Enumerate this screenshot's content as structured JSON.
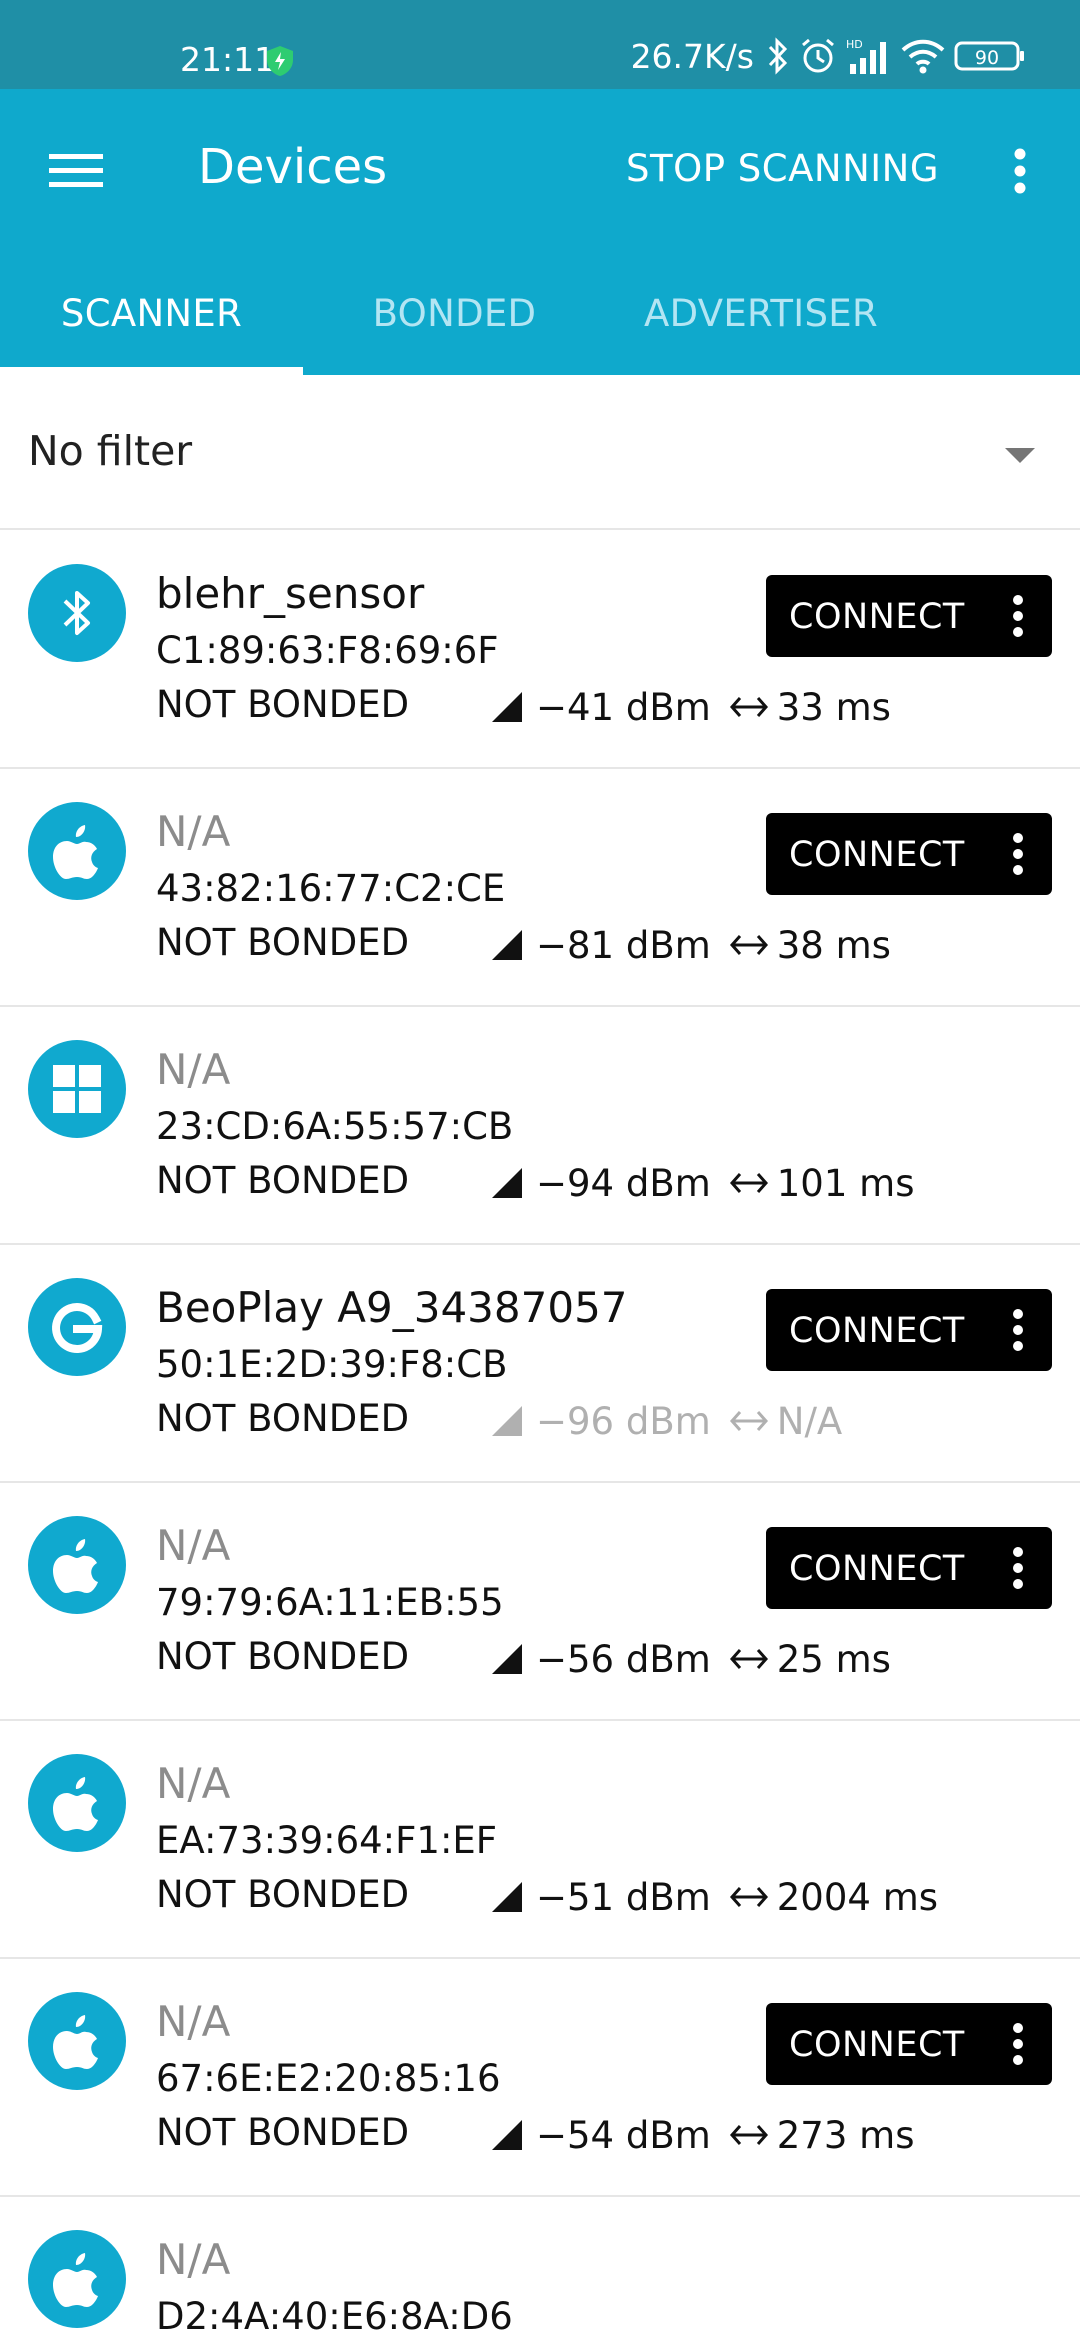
{
  "status_bar": {
    "time": "21:11",
    "net_speed": "26.7K/s",
    "battery": "90",
    "icons": [
      "shield-icon",
      "bluetooth-icon",
      "alarm-icon",
      "cell-signal-icon",
      "wifi-icon",
      "battery-icon"
    ]
  },
  "app_bar": {
    "title": "Devices",
    "action_label": "STOP SCANNING",
    "icons": [
      "menu-icon",
      "more-vert-icon"
    ],
    "background": "#0fa9cc",
    "status_background": "#1f8fa6"
  },
  "tabs": [
    {
      "label": "SCANNER",
      "active": true
    },
    {
      "label": "BONDED",
      "active": false
    },
    {
      "label": "ADVERTISER",
      "active": false
    }
  ],
  "filter": {
    "label": "No filter"
  },
  "devices": [
    {
      "icon": "bluetooth-icon",
      "name": "blehr_sensor",
      "name_available": true,
      "address": "C1:89:63:F8:69:6F",
      "bond_state": "NOT BONDED",
      "rssi": "−41 dBm",
      "interval": "33 ms",
      "dim": false,
      "connect_label": "CONNECT"
    },
    {
      "icon": "apple-icon",
      "name": "N/A",
      "name_available": false,
      "address": "43:82:16:77:C2:CE",
      "bond_state": "NOT BONDED",
      "rssi": "−81 dBm",
      "interval": "38 ms",
      "dim": false,
      "connect_label": "CONNECT"
    },
    {
      "icon": "windows-icon",
      "name": "N/A",
      "name_available": false,
      "address": "23:CD:6A:55:57:CB",
      "bond_state": "NOT BONDED",
      "rssi": "−94 dBm",
      "interval": "101 ms",
      "dim": false,
      "connect_label": ""
    },
    {
      "icon": "google-icon",
      "name": "BeoPlay A9_34387057",
      "name_available": true,
      "address": "50:1E:2D:39:F8:CB",
      "bond_state": "NOT BONDED",
      "rssi": "−96 dBm",
      "interval": "N/A",
      "dim": true,
      "connect_label": "CONNECT"
    },
    {
      "icon": "apple-icon",
      "name": "N/A",
      "name_available": false,
      "address": "79:79:6A:11:EB:55",
      "bond_state": "NOT BONDED",
      "rssi": "−56 dBm",
      "interval": "25 ms",
      "dim": false,
      "connect_label": "CONNECT"
    },
    {
      "icon": "apple-icon",
      "name": "N/A",
      "name_available": false,
      "address": "EA:73:39:64:F1:EF",
      "bond_state": "NOT BONDED",
      "rssi": "−51 dBm",
      "interval": "2004 ms",
      "dim": false,
      "connect_label": ""
    },
    {
      "icon": "apple-icon",
      "name": "N/A",
      "name_available": false,
      "address": "67:6E:E2:20:85:16",
      "bond_state": "NOT BONDED",
      "rssi": "−54 dBm",
      "interval": "273 ms",
      "dim": false,
      "connect_label": "CONNECT"
    },
    {
      "icon": "apple-icon",
      "name": "N/A",
      "name_available": false,
      "address": "D2:4A:40:E6:8A:D6",
      "bond_state": "",
      "rssi": "",
      "interval": "",
      "dim": false,
      "connect_label": ""
    }
  ]
}
